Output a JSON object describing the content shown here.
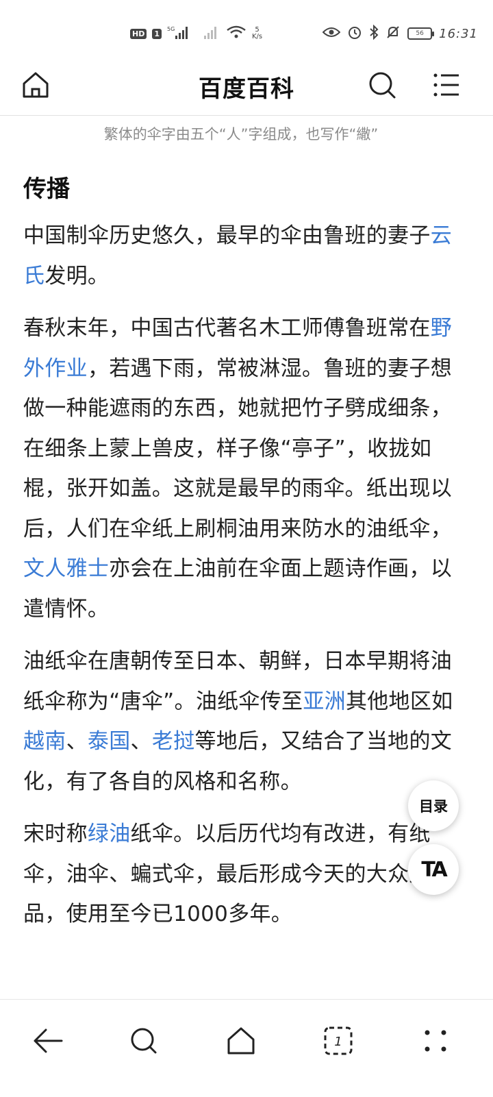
{
  "status_bar": {
    "hd": "HD",
    "sim": "1",
    "network": "5G",
    "speed_value": "5",
    "speed_unit": "K/s",
    "battery": "56",
    "time": "16:31"
  },
  "header": {
    "title": "百度百科"
  },
  "caption": "繁体的伞字由五个“人”字组成，也写作“繖”",
  "section": {
    "title": "传播"
  },
  "paragraphs": [
    {
      "runs": [
        {
          "text": "中国制伞历史悠久，最早的伞由鲁班的妻子"
        },
        {
          "text": "云氏",
          "link": true
        },
        {
          "text": "发明。"
        }
      ]
    },
    {
      "runs": [
        {
          "text": "春秋末年，中国古代著名木工师傅鲁班常在"
        },
        {
          "text": "野外作业",
          "link": true
        },
        {
          "text": "，若遇下雨，常被淋湿。鲁班的妻子想做一种能遮雨的东西，她就把竹子劈成细条，在细条上蒙上兽皮，样子像“亭子”，收拢如棍，张开如盖。这就是最早的雨伞。纸出现以后，人们在伞纸上刷桐油用来防水的油纸伞，"
        },
        {
          "text": "文人雅士",
          "link": true
        },
        {
          "text": "亦会在上油前在伞面上题诗作画，以遣情怀。"
        }
      ]
    },
    {
      "runs": [
        {
          "text": "油纸伞在唐朝传至日本、朝鲜，日本早期将油纸伞称为“唐伞”。油纸伞传至"
        },
        {
          "text": "亚洲",
          "link": true
        },
        {
          "text": "其他地区如"
        },
        {
          "text": "越南",
          "link": true
        },
        {
          "text": "、"
        },
        {
          "text": "泰国",
          "link": true
        },
        {
          "text": "、"
        },
        {
          "text": "老挝",
          "link": true
        },
        {
          "text": "等地后，又结合了当地的文化，有了各自的风格和名称。"
        }
      ]
    },
    {
      "runs": [
        {
          "text": "宋时称"
        },
        {
          "text": "绿油",
          "link": true
        },
        {
          "text": "纸伞。以后历代均有改进，有纸伞，油伞、蝙式伞，最后形成今天的大众用品，使用至今已1000多年。"
        }
      ]
    }
  ],
  "floating": {
    "toc_label": "目录",
    "ta_label": "TA"
  },
  "bottom_nav": {
    "tab_count": "1"
  },
  "colors": {
    "link": "#3a7bd5",
    "text": "#222222",
    "caption": "#8a8a8a"
  }
}
